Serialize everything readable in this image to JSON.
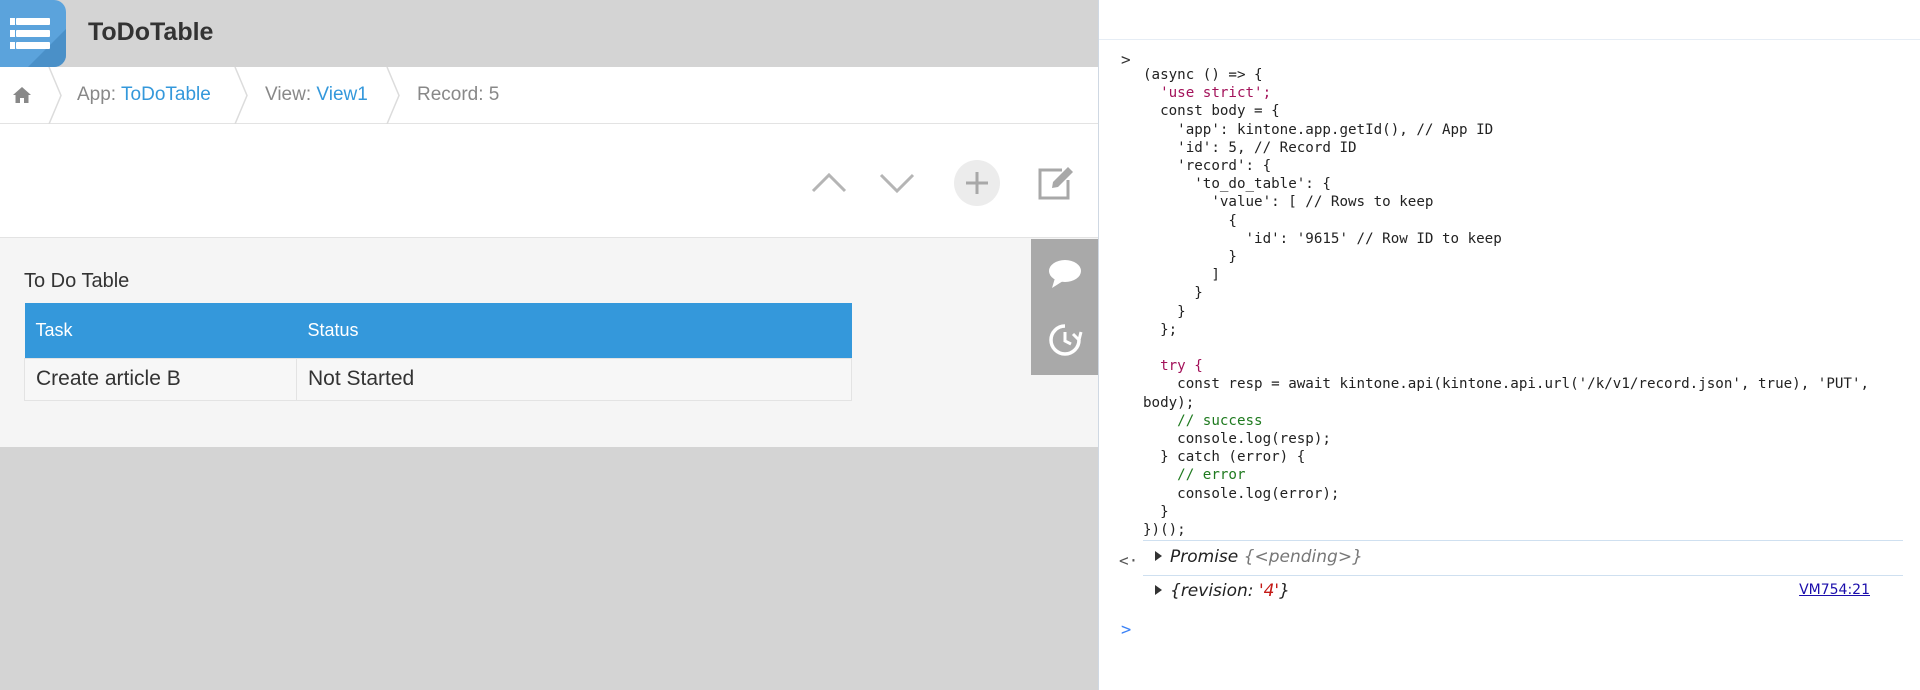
{
  "app": {
    "title": "ToDoTable",
    "breadcrumb": {
      "app_prefix": "App: ",
      "app_link": "ToDoTable",
      "view_prefix": "View: ",
      "view_link": "View1",
      "record": "Record: 5"
    },
    "toolbar": {
      "icons": [
        "chevron-up-icon",
        "chevron-down-icon",
        "plus-icon",
        "edit-icon"
      ]
    },
    "record": {
      "field_label": "To Do Table",
      "columns": [
        "Task",
        "Status"
      ],
      "rows": [
        {
          "task": "Create article B",
          "status": "Not Started"
        }
      ]
    },
    "side_panel": {
      "icons": [
        "comment-icon",
        "history-icon"
      ]
    }
  },
  "console": {
    "input_lines": [
      "(async () => {",
      "  'use strict';",
      "  const body = {",
      "    'app': kintone.app.getId(), // App ID",
      "    'id': 5, // Record ID",
      "    'record': {",
      "      'to_do_table': {",
      "        'value': [ // Rows to keep",
      "          {",
      "            'id': '9615' // Row ID to keep",
      "          }",
      "        ]",
      "      }",
      "    }",
      "  };",
      "",
      "  try {",
      "    const resp = await kintone.api(kintone.api.url('/k/v1/record.json', true), 'PUT',",
      "body);",
      "    // success",
      "    console.log(resp);",
      "  } catch (error) {",
      "    // error",
      "    console.log(error);",
      "  }",
      "})();"
    ],
    "return_value": {
      "label": "Promise",
      "state": "{<pending>}"
    },
    "log_output": {
      "prefix": "{revision: ",
      "value": "'4'",
      "suffix": "}"
    },
    "source_link": "VM754:21",
    "prompt_symbol": ">",
    "return_symbol": "<·"
  },
  "colors": {
    "accent": "#3498db",
    "app_bg": "#d4d4d4",
    "keyword": "#a3125a",
    "string": "#c41a16",
    "comment": "#1f7a1f"
  }
}
